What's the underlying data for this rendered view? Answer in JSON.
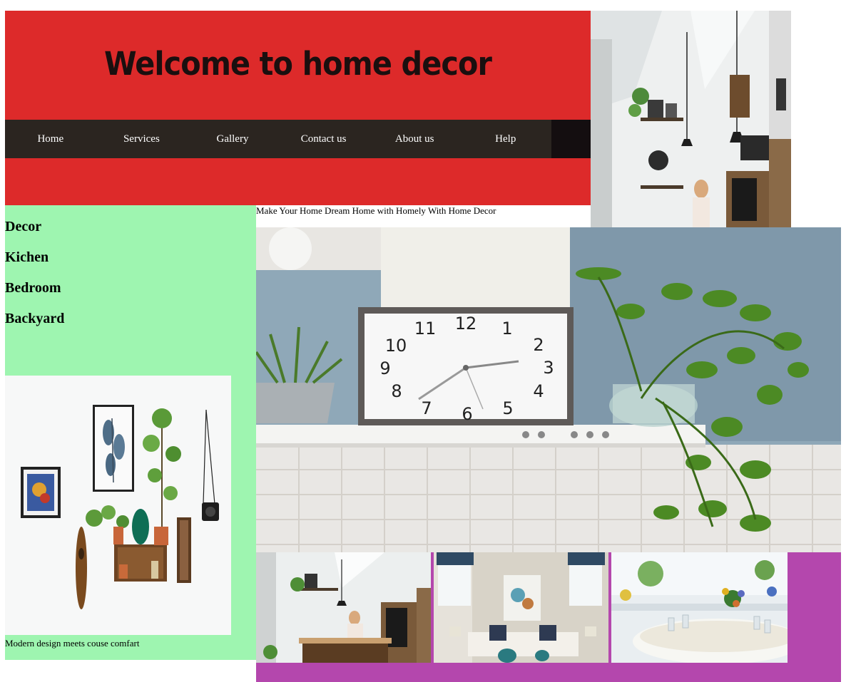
{
  "header": {
    "title": "Welcome to home decor"
  },
  "nav": {
    "items": [
      {
        "label": "Home"
      },
      {
        "label": "Services"
      },
      {
        "label": "Gallery"
      },
      {
        "label": "Contact us"
      },
      {
        "label": "About us"
      },
      {
        "label": "Help"
      }
    ]
  },
  "tagline": "Make Your Home Dream Home with Homely With Home Decor",
  "sidebar": {
    "items": [
      {
        "label": "Decor"
      },
      {
        "label": "Kichen"
      },
      {
        "label": "Bedroom"
      },
      {
        "label": "Backyard"
      }
    ],
    "caption": "Modern design meets couse comfart"
  },
  "colors": {
    "header_bg": "#dd2a2a",
    "nav_bg": "#2b2520",
    "sidebar_bg": "#9ef5b0",
    "gallery_bg": "#b447ad"
  },
  "photos": {
    "main_clock": {
      "clock_numbers": [
        "12",
        "1",
        "2",
        "3",
        "4",
        "5",
        "6",
        "7",
        "8",
        "9",
        "10",
        "11"
      ]
    }
  }
}
